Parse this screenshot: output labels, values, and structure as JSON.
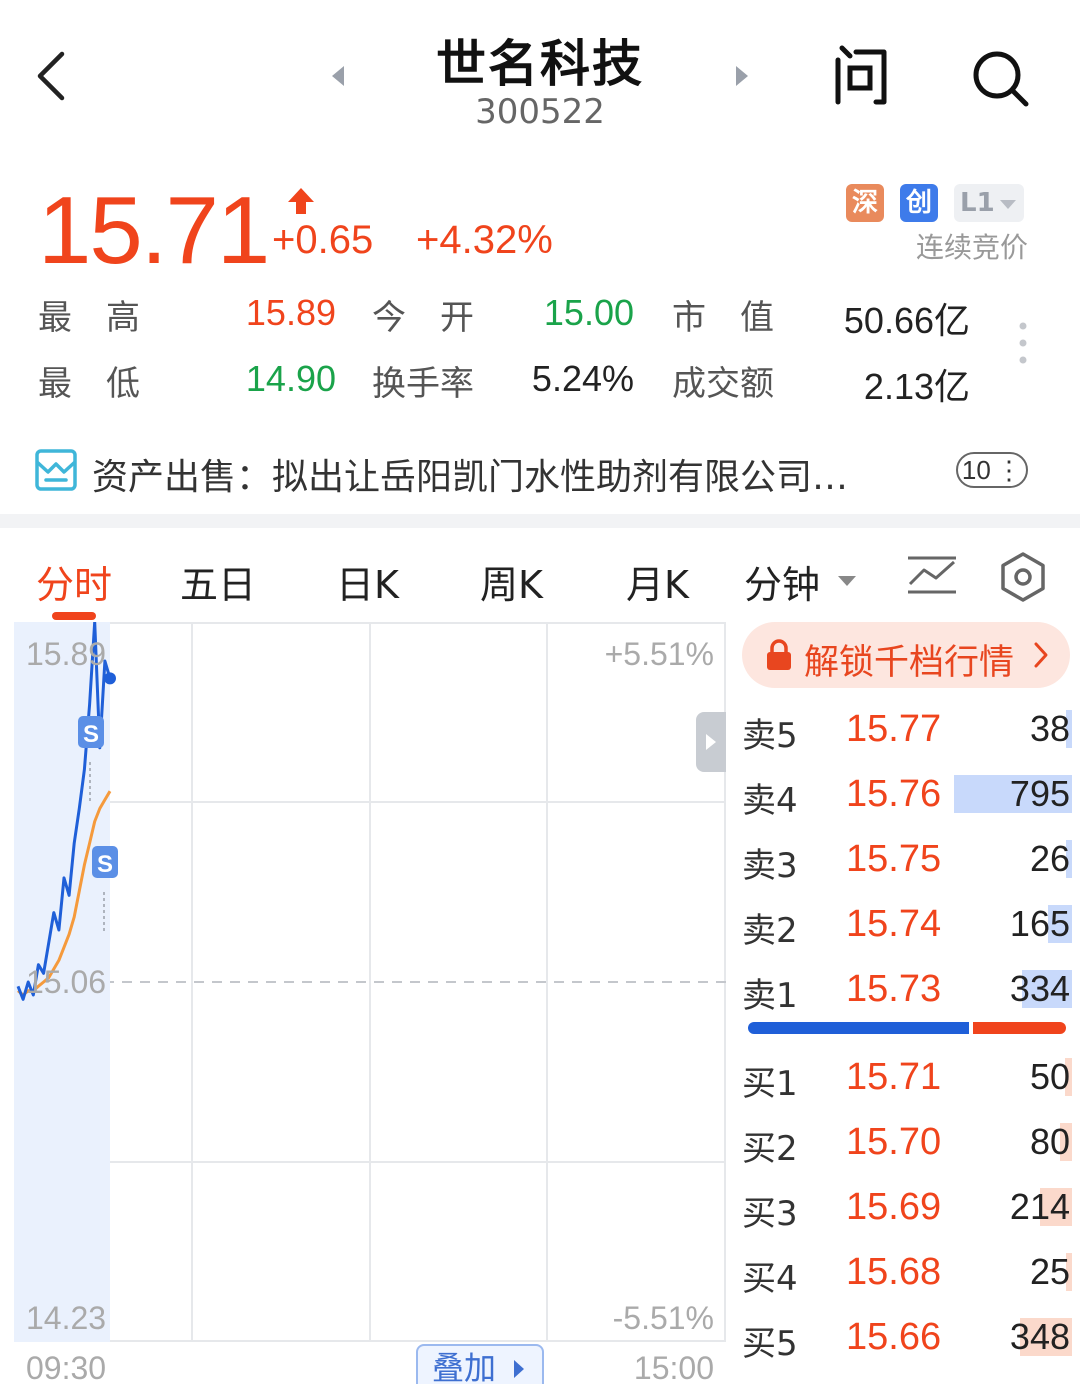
{
  "header": {
    "title": "世名科技",
    "code": "300522"
  },
  "quote": {
    "price": "15.71",
    "change": "+0.65",
    "change_pct": "+4.32%",
    "tags": [
      "深",
      "创",
      "L1"
    ],
    "auction_label": "连续竞价",
    "stats": [
      {
        "label": "最　高",
        "value": "15.89",
        "color": "red"
      },
      {
        "label": "今　开",
        "value": "15.00",
        "color": "green"
      },
      {
        "label": "市　值",
        "value": "50.66亿",
        "color": "neutral"
      },
      {
        "label": "最　低",
        "value": "14.90",
        "color": "green"
      },
      {
        "label": "换手率",
        "value": "5.24%",
        "color": "neutral"
      },
      {
        "label": "成交额",
        "value": "2.13亿",
        "color": "neutral"
      }
    ]
  },
  "news": {
    "text": "资产出售：拟出让岳阳凯门水性助剂有限公司…",
    "count": "10"
  },
  "tabs": {
    "items": [
      "分时",
      "五日",
      "日K",
      "周K",
      "月K",
      "分钟"
    ],
    "active": "分时"
  },
  "chart": {
    "y_top": "15.89",
    "y_mid": "15.06",
    "y_bottom": "14.23",
    "pct_top": "+5.51%",
    "pct_bottom": "-5.51%",
    "time_start": "09:30",
    "time_end": "15:00",
    "overlay_label": "叠加",
    "marker_label": "S"
  },
  "chart_data": {
    "type": "line",
    "ylim": [
      14.23,
      15.89
    ],
    "reference_price": 15.06,
    "x_range": [
      "09:30",
      "15:00"
    ],
    "series": [
      {
        "values": [
          15.05,
          15.02,
          15.06,
          15.03,
          15.1,
          15.08,
          15.15,
          15.22,
          15.18,
          15.3,
          15.26,
          15.38,
          15.46,
          15.55,
          15.7,
          15.89,
          15.6,
          15.8,
          15.76
        ],
        "color": "#1f5fd8"
      },
      {
        "values": [
          15.04,
          15.03,
          15.04,
          15.04,
          15.05,
          15.06,
          15.07,
          15.09,
          15.11,
          15.14,
          15.17,
          15.21,
          15.27,
          15.33,
          15.38,
          15.43,
          15.46,
          15.48,
          15.5
        ],
        "color": "#f59a3c"
      }
    ],
    "grid": true
  },
  "order_book": {
    "unlock_label": "解锁千档行情",
    "asks": [
      {
        "label": "卖5",
        "price": "15.77",
        "volume": "38",
        "vol": 38
      },
      {
        "label": "卖4",
        "price": "15.76",
        "volume": "795",
        "vol": 795
      },
      {
        "label": "卖3",
        "price": "15.75",
        "volume": "26",
        "vol": 26
      },
      {
        "label": "卖2",
        "price": "15.74",
        "volume": "165",
        "vol": 165
      },
      {
        "label": "卖1",
        "price": "15.73",
        "volume": "334",
        "vol": 334
      }
    ],
    "bids": [
      {
        "label": "买1",
        "price": "15.71",
        "volume": "50",
        "vol": 50
      },
      {
        "label": "买2",
        "price": "15.70",
        "volume": "80",
        "vol": 80
      },
      {
        "label": "买3",
        "price": "15.69",
        "volume": "214",
        "vol": 214
      },
      {
        "label": "买4",
        "price": "15.68",
        "volume": "25",
        "vol": 25
      },
      {
        "label": "买5",
        "price": "15.66",
        "volume": "348",
        "vol": 348
      }
    ],
    "buy_sell_ratio": 0.7
  },
  "colors": {
    "up": "#f0441c",
    "down": "#1aa34a",
    "accent_blue": "#1f5fd8"
  }
}
